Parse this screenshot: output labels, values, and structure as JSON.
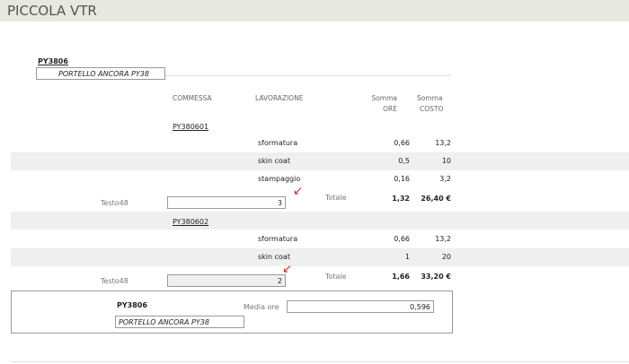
{
  "header": {
    "title": "PICCOLA VTR"
  },
  "group": {
    "code": "PY3806",
    "description": "PORTELLO ANCORA PY38"
  },
  "columns": {
    "commessa": "COMMESSA",
    "lavorazione": "LAVORAZIONE",
    "somma_ore": [
      "Somma",
      "ORE"
    ],
    "somma_costo": [
      "Somma",
      "COSTO"
    ]
  },
  "sections": [
    {
      "commessa": "PY380601",
      "rows": [
        {
          "lavorazione": "sformatura",
          "ore": "0,66",
          "costo": "13,2"
        },
        {
          "lavorazione": "skin coat",
          "ore": "0,5",
          "costo": "10"
        },
        {
          "lavorazione": "stampaggio",
          "ore": "0,16",
          "costo": "3,2"
        }
      ],
      "testo_label": "Testo48",
      "testo_value": "3",
      "totale_label": "Totale",
      "totale_ore": "1,32",
      "totale_costo": "26,40 €"
    },
    {
      "commessa": "PY380602",
      "rows": [
        {
          "lavorazione": "sformatura",
          "ore": "0,66",
          "costo": "13,2"
        },
        {
          "lavorazione": "skin coat",
          "ore": "1",
          "costo": "20"
        }
      ],
      "testo_label": "Testo48",
      "testo_value": "2",
      "totale_label": "Totale",
      "totale_ore": "1,66",
      "totale_costo": "33,20 €"
    }
  ],
  "footer": {
    "code": "PY3806",
    "description": "PORTELLO ANCORA PY38",
    "media_label": "Media ore",
    "media_value": "0,596"
  },
  "colors": {
    "title_bar": "#e6e8e1",
    "band": "#efefef",
    "annotation": "#d62020"
  }
}
